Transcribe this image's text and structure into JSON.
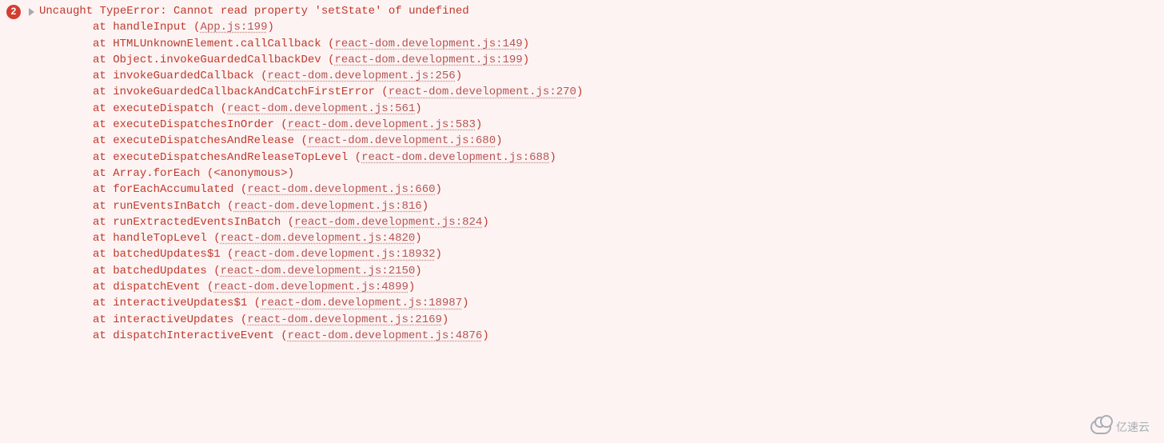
{
  "error": {
    "count": "2",
    "message": "Uncaught TypeError: Cannot read property 'setState' of undefined",
    "frames": [
      {
        "fn": "handleInput",
        "src": "App.js:199"
      },
      {
        "fn": "HTMLUnknownElement.callCallback",
        "src": "react-dom.development.js:149"
      },
      {
        "fn": "Object.invokeGuardedCallbackDev",
        "src": "react-dom.development.js:199"
      },
      {
        "fn": "invokeGuardedCallback",
        "src": "react-dom.development.js:256"
      },
      {
        "fn": "invokeGuardedCallbackAndCatchFirstError",
        "src": "react-dom.development.js:270"
      },
      {
        "fn": "executeDispatch",
        "src": "react-dom.development.js:561"
      },
      {
        "fn": "executeDispatchesInOrder",
        "src": "react-dom.development.js:583"
      },
      {
        "fn": "executeDispatchesAndRelease",
        "src": "react-dom.development.js:680"
      },
      {
        "fn": "executeDispatchesAndReleaseTopLevel",
        "src": "react-dom.development.js:688"
      },
      {
        "fn": "Array.forEach",
        "src": "<anonymous>",
        "anon": true
      },
      {
        "fn": "forEachAccumulated",
        "src": "react-dom.development.js:660"
      },
      {
        "fn": "runEventsInBatch",
        "src": "react-dom.development.js:816"
      },
      {
        "fn": "runExtractedEventsInBatch",
        "src": "react-dom.development.js:824"
      },
      {
        "fn": "handleTopLevel",
        "src": "react-dom.development.js:4820"
      },
      {
        "fn": "batchedUpdates$1",
        "src": "react-dom.development.js:18932"
      },
      {
        "fn": "batchedUpdates",
        "src": "react-dom.development.js:2150"
      },
      {
        "fn": "dispatchEvent",
        "src": "react-dom.development.js:4899"
      },
      {
        "fn": "interactiveUpdates$1",
        "src": "react-dom.development.js:18987"
      },
      {
        "fn": "interactiveUpdates",
        "src": "react-dom.development.js:2169"
      },
      {
        "fn": "dispatchInteractiveEvent",
        "src": "react-dom.development.js:4876"
      }
    ]
  },
  "labels": {
    "at": "at "
  },
  "watermark": "亿速云"
}
